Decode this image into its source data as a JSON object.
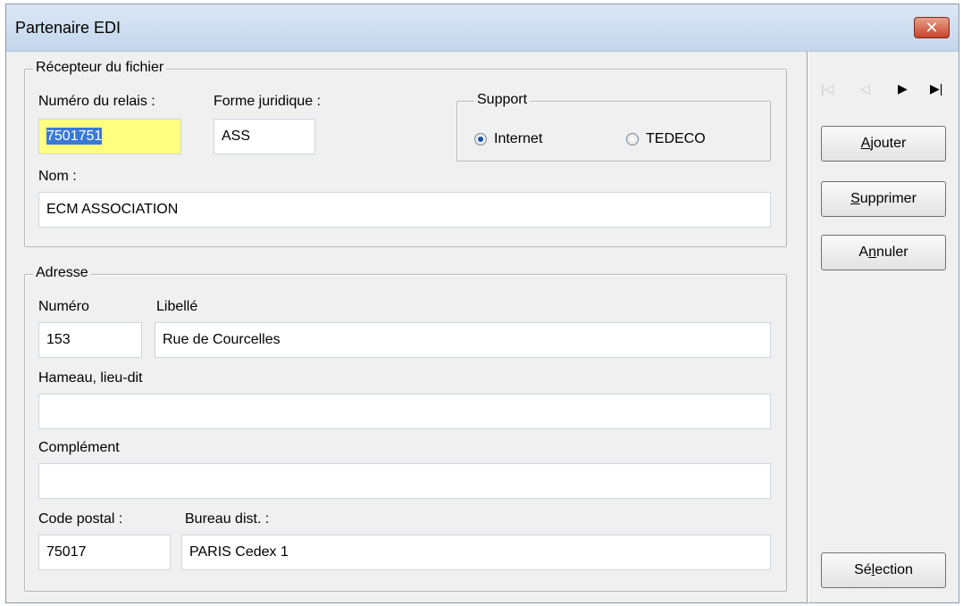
{
  "window": {
    "title": "Partenaire EDI",
    "close_label": "✕"
  },
  "recepteur": {
    "legend": "Récepteur du fichier",
    "numero_relais_label": "Numéro du relais :",
    "numero_relais_value": "7501751",
    "forme_juridique_label": "Forme juridique :",
    "forme_juridique_value": "ASS",
    "nom_label": "Nom :",
    "nom_value": "ECM ASSOCIATION",
    "support": {
      "legend": "Support",
      "options": [
        {
          "label": "Internet",
          "checked": true
        },
        {
          "label": "TEDECO",
          "checked": false
        }
      ]
    }
  },
  "adresse": {
    "legend": "Adresse",
    "numero_label": "Numéro",
    "numero_value": "153",
    "libelle_label": "Libellé",
    "libelle_value": "Rue de Courcelles",
    "hameau_label": "Hameau, lieu-dit",
    "hameau_value": "",
    "complement_label": "Complément",
    "complement_value": "",
    "code_postal_label": "Code postal :",
    "code_postal_value": "75017",
    "bureau_label": "Bureau dist. :",
    "bureau_value": "PARIS Cedex 1"
  },
  "navigation": {
    "first": "|◁",
    "prev": "◁",
    "next": "▶",
    "last": "▶|"
  },
  "buttons": {
    "ajouter": {
      "mnemonic": "A",
      "rest": "jouter"
    },
    "supprimer": {
      "mnemonic": "S",
      "rest": "upprimer"
    },
    "annuler": {
      "pre": "A",
      "mnemonic": "n",
      "rest": "nuler"
    },
    "selection": {
      "pre": "Sé",
      "mnemonic": "l",
      "rest": "ection"
    }
  }
}
